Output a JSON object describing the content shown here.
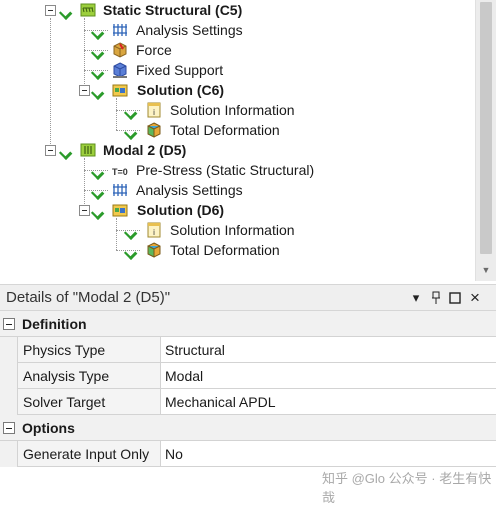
{
  "tree": {
    "static_structural": {
      "label": "Static Structural (C5)",
      "children": [
        "Analysis Settings",
        "Force",
        "Fixed Support"
      ],
      "solution": {
        "label": "Solution (C6)",
        "children": [
          "Solution Information",
          "Total Deformation"
        ]
      }
    },
    "modal": {
      "label": "Modal 2 (D5)",
      "children": [
        "Pre-Stress (Static Structural)",
        "Analysis Settings"
      ],
      "solution": {
        "label": "Solution (D6)",
        "children": [
          "Solution Information",
          "Total Deformation"
        ]
      }
    },
    "icon_text": {
      "pre_stress": "T=0"
    }
  },
  "details": {
    "title": "Details of \"Modal 2 (D5)\"",
    "toolbar": {
      "menu": "▾",
      "pin": "📌",
      "maximize": "□",
      "close": "×"
    },
    "sections": [
      {
        "label": "Definition",
        "rows": [
          {
            "key": "Physics Type",
            "value": "Structural"
          },
          {
            "key": "Analysis Type",
            "value": "Modal"
          },
          {
            "key": "Solver Target",
            "value": "Mechanical APDL"
          }
        ]
      },
      {
        "label": "Options",
        "rows": [
          {
            "key": "Generate Input Only",
            "value": "No"
          }
        ]
      }
    ]
  },
  "watermark": "知乎 @Glo  公众号 · 老生有快哉",
  "colors": {
    "check": "#2b9b2b",
    "tree_line": "#9a9a9a",
    "panel_bg": "#efefef",
    "grid_line": "#d3d3d3"
  }
}
